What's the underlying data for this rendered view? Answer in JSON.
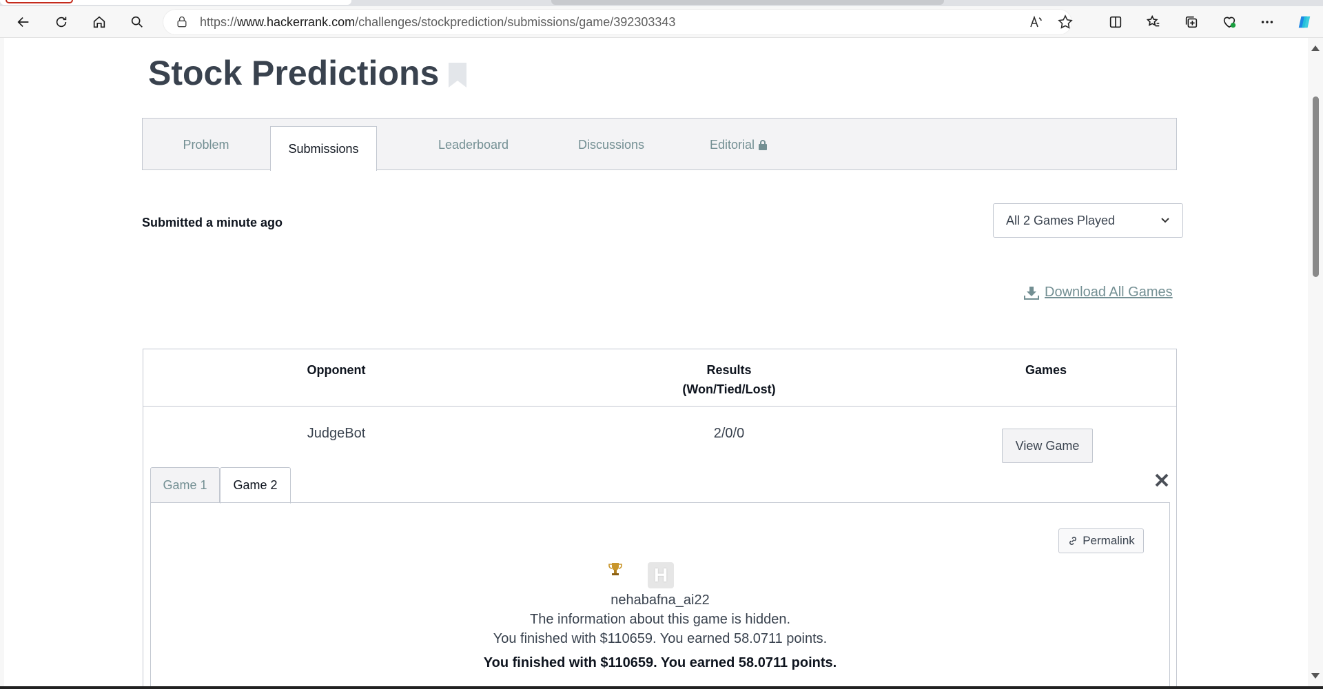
{
  "browser": {
    "url_prefix": "https://",
    "url_domain": "www.hackerrank.com",
    "url_path": "/challenges/stockprediction/submissions/game/392303343"
  },
  "page": {
    "title": "Stock Predictions",
    "tabs": [
      {
        "label": "Problem"
      },
      {
        "label": "Submissions"
      },
      {
        "label": "Leaderboard"
      },
      {
        "label": "Discussions"
      },
      {
        "label": "Editorial"
      }
    ],
    "submitted_text": "Submitted a minute ago",
    "games_select": "All 2 Games Played",
    "download_label": "Download All Games"
  },
  "results_table": {
    "headers": {
      "opponent": "Opponent",
      "results": "Results",
      "results_sub": "(Won/Tied/Lost)",
      "games": "Games"
    },
    "row": {
      "opponent": "JudgeBot",
      "results": "2/0/0",
      "action": "View Game"
    }
  },
  "game_view": {
    "tabs": [
      {
        "label": "Game 1"
      },
      {
        "label": "Game 2"
      }
    ],
    "permalink_label": "Permalink",
    "player_icon_letter": "H",
    "username": "nehabafna_ai22",
    "hidden_msg": "The information about this game is hidden.",
    "result_msg": "You finished with $110659. You earned 58.0711 points.",
    "result_msg_bold": "You finished with $110659. You earned 58.0711 points."
  },
  "colors": {
    "accent_text": "#39424e",
    "muted": "#738f93",
    "border": "#c2c7d0"
  }
}
